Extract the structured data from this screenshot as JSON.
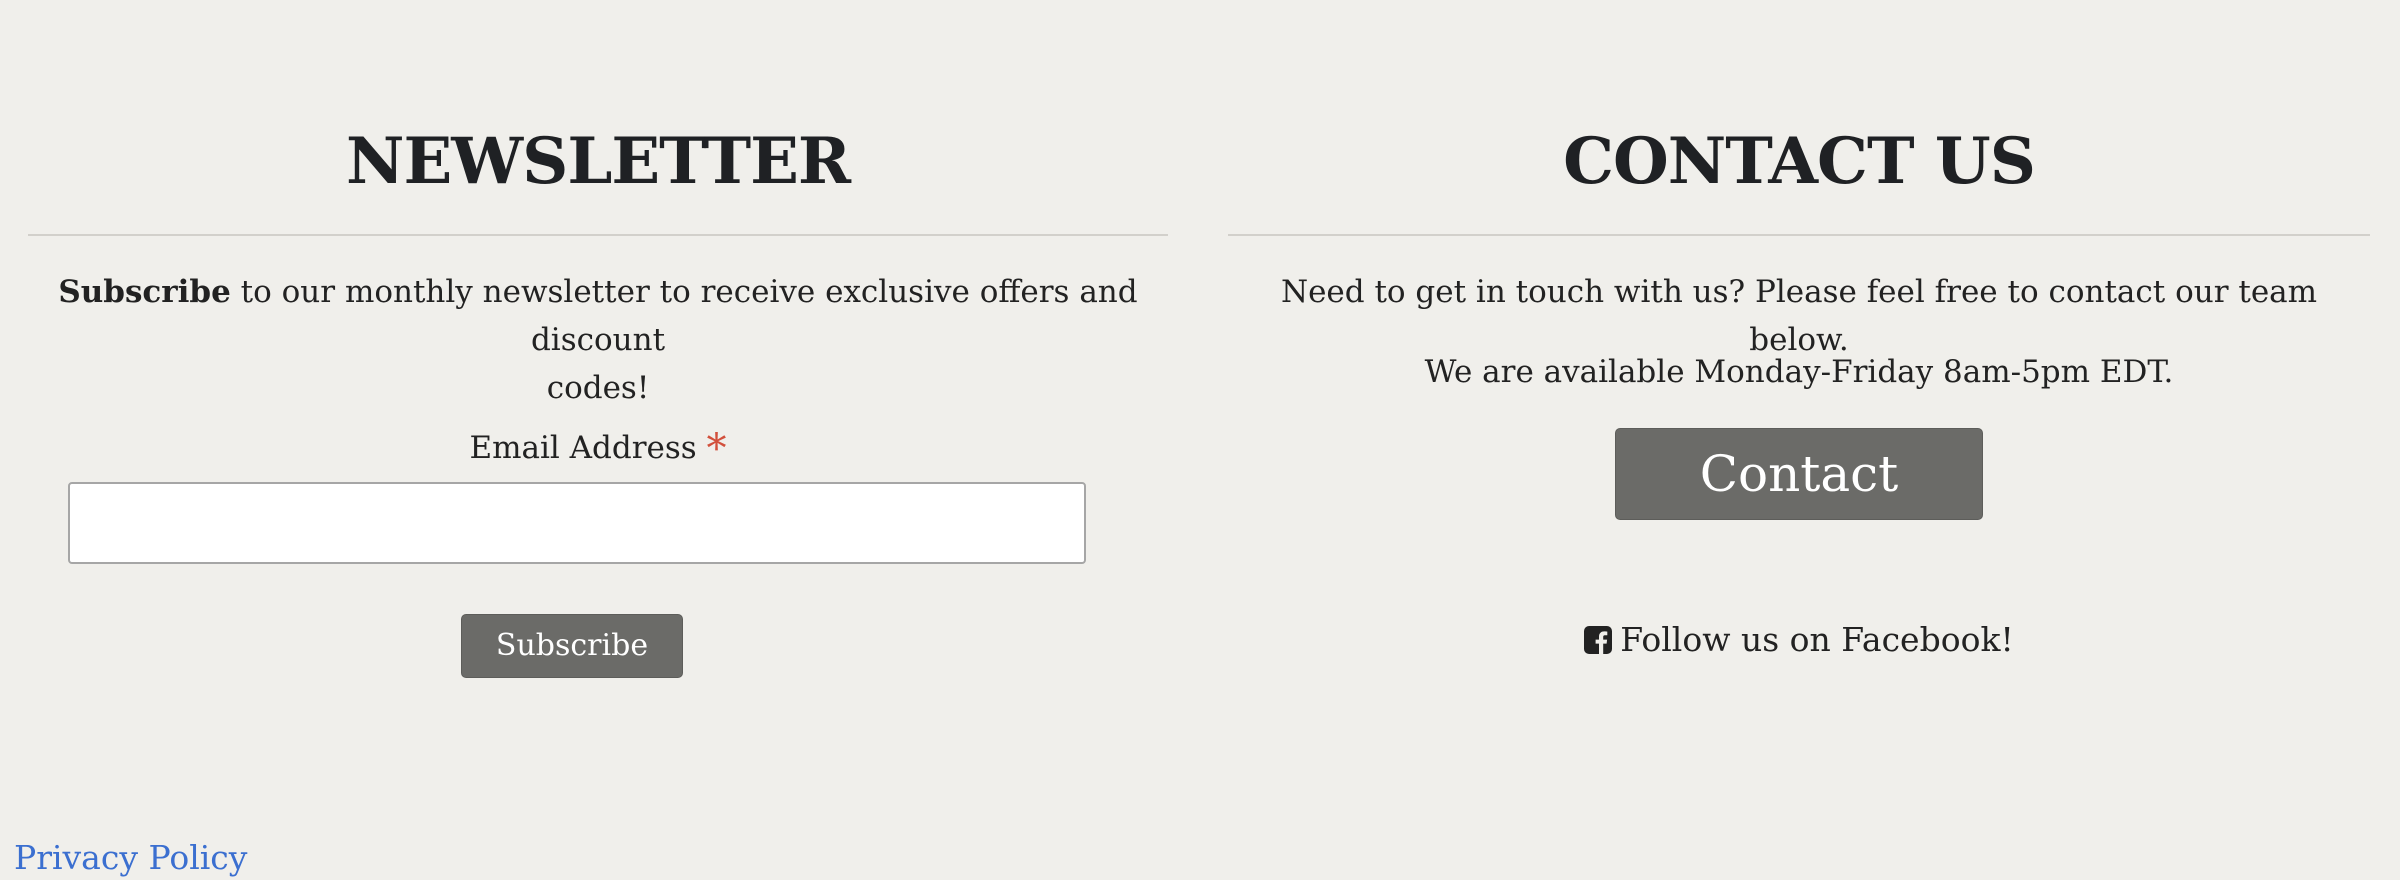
{
  "newsletter": {
    "title": "NEWSLETTER",
    "intro_bold": "Subscribe",
    "intro_rest_line1": " to our monthly newsletter to receive exclusive offers and discount",
    "intro_rest_line2": "codes!",
    "email_label": "Email Address",
    "required_mark": "*",
    "email_value": "",
    "subscribe_label": "Subscribe"
  },
  "contact": {
    "title": "CONTACT US",
    "line1": "Need to get in touch with us? Please feel free to contact our team below.",
    "line2": "We are available Monday-Friday 8am-5pm EDT.",
    "contact_label": "Contact",
    "facebook_text": "Follow us on Facebook!",
    "facebook_icon": "facebook-square-icon"
  },
  "footer": {
    "privacy_label": "Privacy Policy"
  },
  "colors": {
    "background": "#f0efeb",
    "text": "#222222",
    "button": "#6b6b68",
    "required": "#d2503c",
    "link": "#3b6fd0"
  }
}
